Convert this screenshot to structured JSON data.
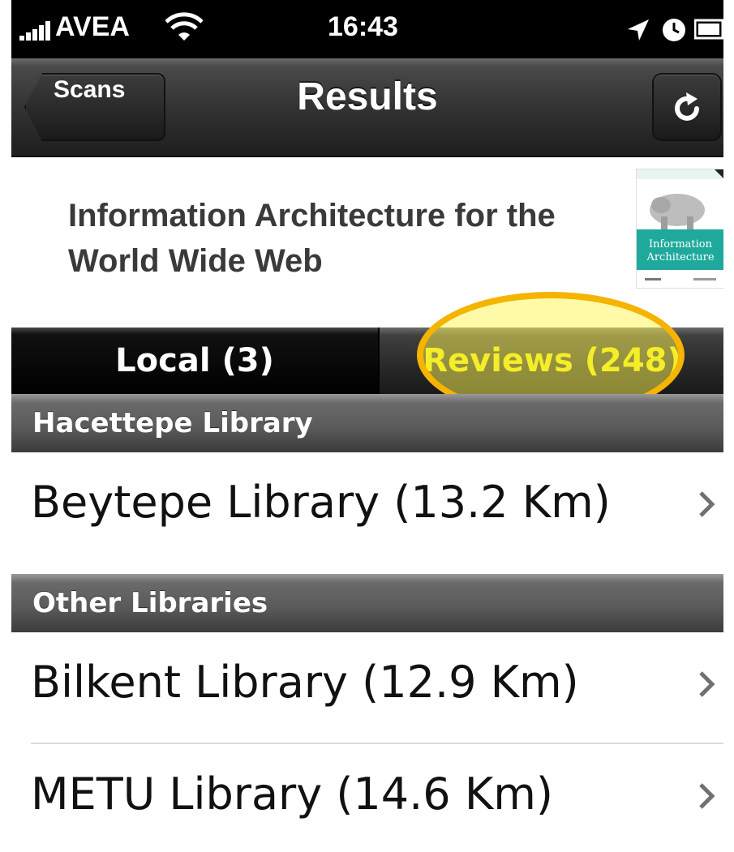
{
  "status_bar": {
    "carrier": "AVEA",
    "time": "16:43",
    "icons": [
      "signal-icon",
      "wifi-icon",
      "location-icon",
      "alarm-icon",
      "battery-icon"
    ]
  },
  "nav_bar": {
    "back_label": "Scans",
    "title": "Results",
    "action_icon": "refresh-icon"
  },
  "book": {
    "title": "Information Architecture for the World Wide Web",
    "cover_title": "Information Architecture"
  },
  "segmented_control": {
    "tabs": [
      {
        "label": "Local (3)"
      },
      {
        "label": "Reviews (248)"
      }
    ]
  },
  "sections": [
    {
      "header": "Hacettepe Library",
      "rows": [
        {
          "label": "Beytepe Library (13.2 Km)"
        }
      ]
    },
    {
      "header": "Other Libraries",
      "rows": [
        {
          "label": "Bilkent Library (12.9 Km)"
        },
        {
          "label": "METU Library (14.6 Km)"
        }
      ]
    }
  ],
  "colors": {
    "highlight_ring": "#f5b400",
    "highlight_fill": "#fff550",
    "reviews_text": "#e6e600"
  }
}
